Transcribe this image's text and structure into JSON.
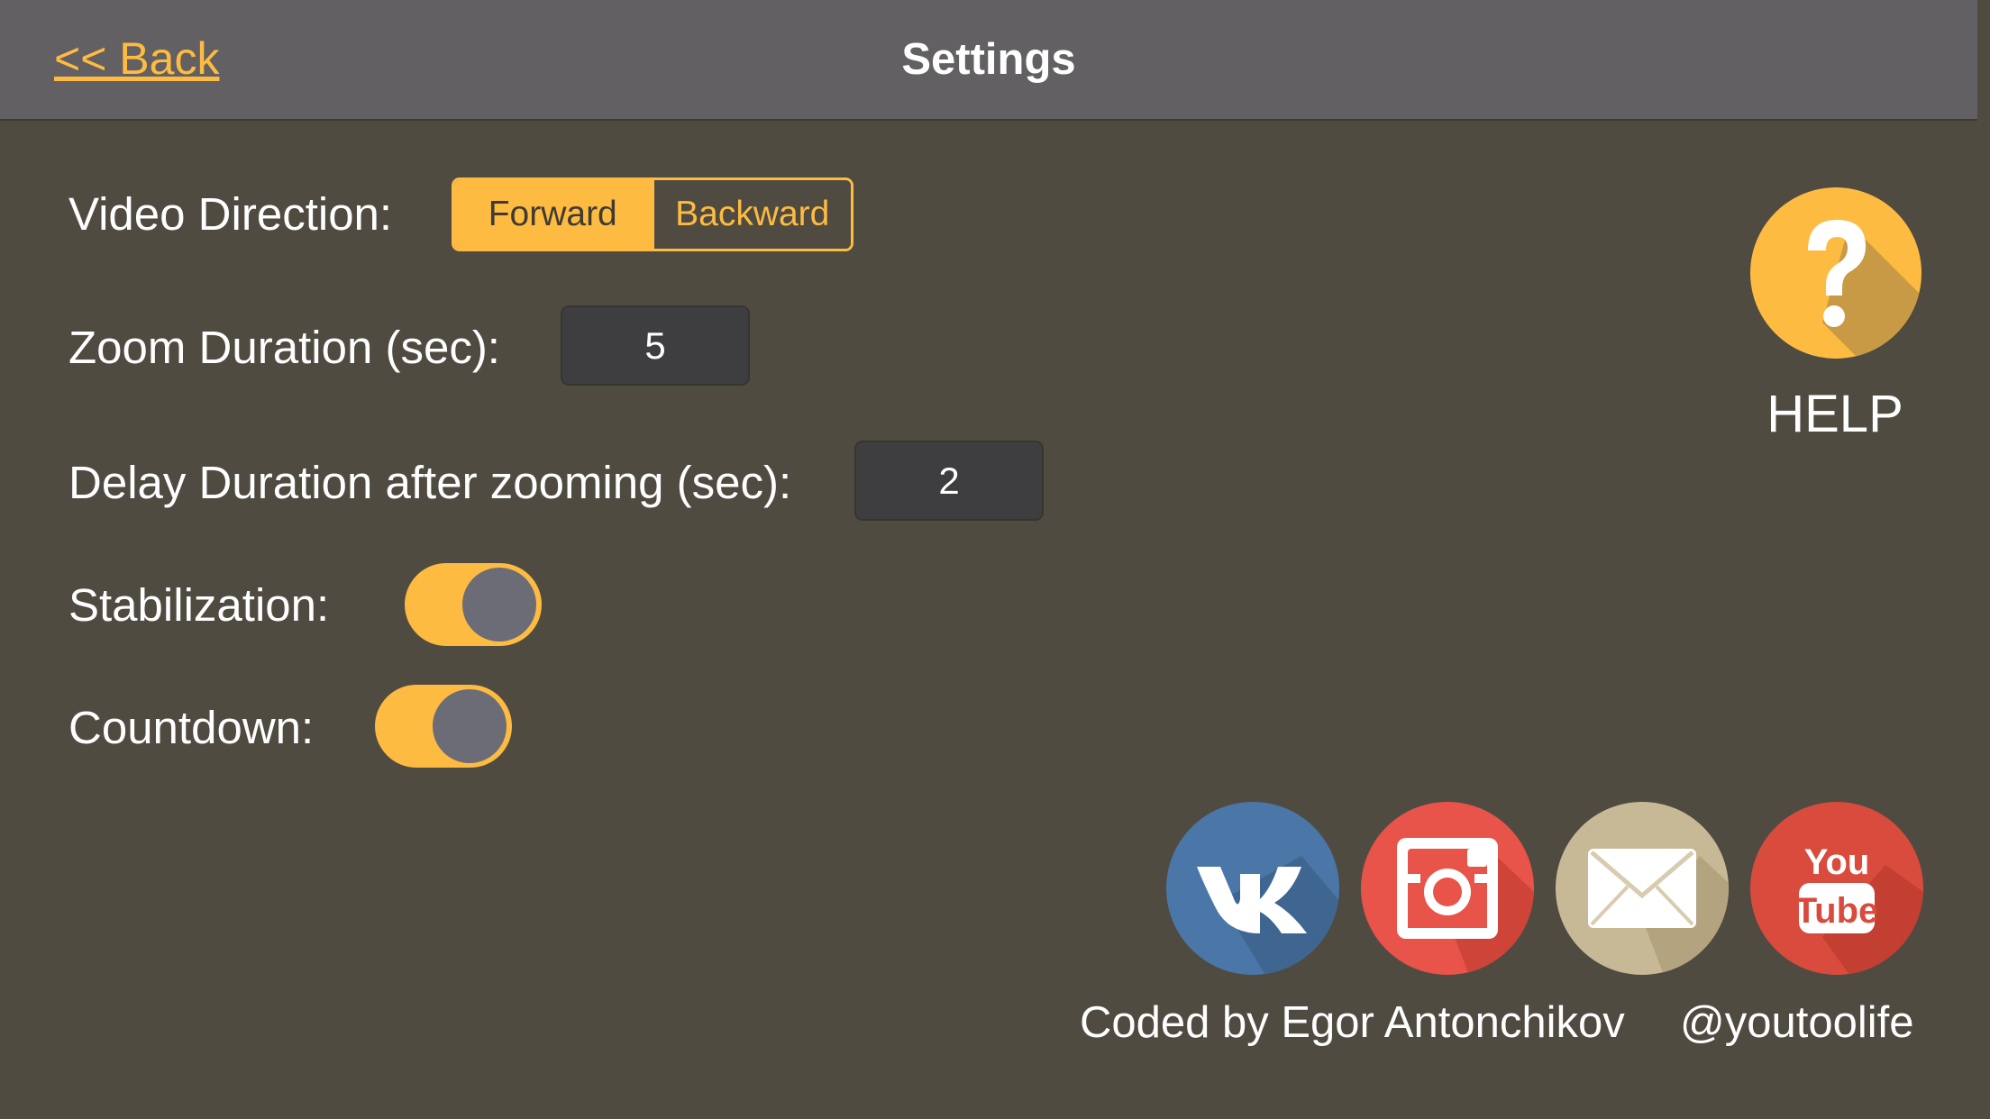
{
  "header": {
    "back_label": "<< Back",
    "title": "Settings"
  },
  "settings": {
    "video_direction": {
      "label": "Video Direction:",
      "options": [
        "Forward",
        "Backward"
      ],
      "selected": "Forward"
    },
    "zoom_duration": {
      "label": "Zoom Duration (sec):",
      "value": "5"
    },
    "delay_duration": {
      "label": "Delay Duration after zooming (sec):",
      "value": "2"
    },
    "stabilization": {
      "label": "Stabilization:",
      "on": true
    },
    "countdown": {
      "label": "Countdown:",
      "on": true
    }
  },
  "help": {
    "label": "HELP",
    "icon": "question-mark-icon"
  },
  "social": [
    {
      "name": "vk-icon",
      "color": "#4a76a8"
    },
    {
      "name": "instagram-icon",
      "color": "#e8534a"
    },
    {
      "name": "mail-icon",
      "color": "#c8b996"
    },
    {
      "name": "youtube-icon",
      "color": "#d84b3d"
    }
  ],
  "footer": {
    "credit": "Coded by Egor Antonchikov",
    "handle": "@youtoolife"
  },
  "colors": {
    "accent": "#fdbb42",
    "background": "#4f4b41",
    "navbar": "#626063"
  }
}
